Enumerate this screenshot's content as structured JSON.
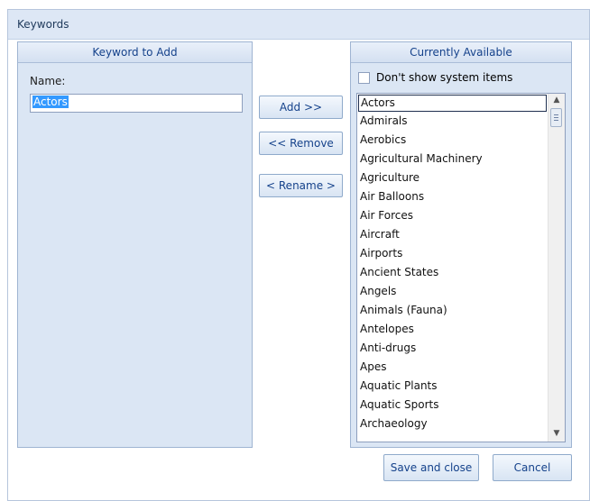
{
  "dialog": {
    "title": "Keywords"
  },
  "left_panel": {
    "header": "Keyword to Add",
    "name_label": "Name:",
    "name_value": "Actors"
  },
  "buttons": {
    "add": "Add >>",
    "remove": "<< Remove",
    "rename": "< Rename >",
    "save_and_close": "Save and close",
    "cancel": "Cancel"
  },
  "right_panel": {
    "header": "Currently Available",
    "checkbox_label": "Don't show system items",
    "items": [
      "Actors",
      "Admirals",
      "Aerobics",
      "Agricultural Machinery",
      "Agriculture",
      "Air Balloons",
      "Air Forces",
      "Aircraft",
      "Airports",
      "Ancient States",
      "Angels",
      "Animals (Fauna)",
      "Antelopes",
      "Anti-drugs",
      "Apes",
      "Aquatic Plants",
      "Aquatic Sports",
      "Archaeology"
    ]
  }
}
